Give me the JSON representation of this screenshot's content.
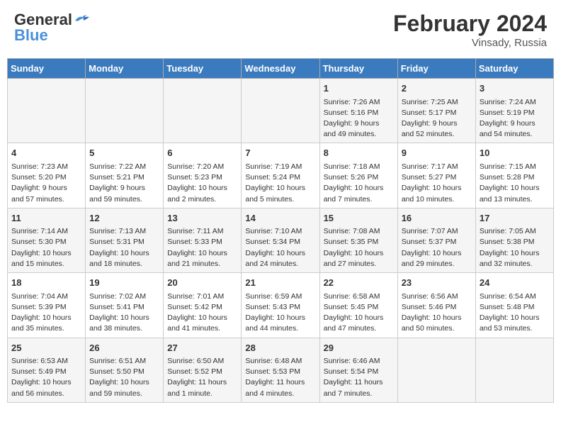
{
  "logo": {
    "part1": "General",
    "part2": "Blue"
  },
  "title": "February 2024",
  "location": "Vinsady, Russia",
  "days_of_week": [
    "Sunday",
    "Monday",
    "Tuesday",
    "Wednesday",
    "Thursday",
    "Friday",
    "Saturday"
  ],
  "weeks": [
    [
      {
        "day": "",
        "info": ""
      },
      {
        "day": "",
        "info": ""
      },
      {
        "day": "",
        "info": ""
      },
      {
        "day": "",
        "info": ""
      },
      {
        "day": "1",
        "info": "Sunrise: 7:26 AM\nSunset: 5:16 PM\nDaylight: 9 hours\nand 49 minutes."
      },
      {
        "day": "2",
        "info": "Sunrise: 7:25 AM\nSunset: 5:17 PM\nDaylight: 9 hours\nand 52 minutes."
      },
      {
        "day": "3",
        "info": "Sunrise: 7:24 AM\nSunset: 5:19 PM\nDaylight: 9 hours\nand 54 minutes."
      }
    ],
    [
      {
        "day": "4",
        "info": "Sunrise: 7:23 AM\nSunset: 5:20 PM\nDaylight: 9 hours\nand 57 minutes."
      },
      {
        "day": "5",
        "info": "Sunrise: 7:22 AM\nSunset: 5:21 PM\nDaylight: 9 hours\nand 59 minutes."
      },
      {
        "day": "6",
        "info": "Sunrise: 7:20 AM\nSunset: 5:23 PM\nDaylight: 10 hours\nand 2 minutes."
      },
      {
        "day": "7",
        "info": "Sunrise: 7:19 AM\nSunset: 5:24 PM\nDaylight: 10 hours\nand 5 minutes."
      },
      {
        "day": "8",
        "info": "Sunrise: 7:18 AM\nSunset: 5:26 PM\nDaylight: 10 hours\nand 7 minutes."
      },
      {
        "day": "9",
        "info": "Sunrise: 7:17 AM\nSunset: 5:27 PM\nDaylight: 10 hours\nand 10 minutes."
      },
      {
        "day": "10",
        "info": "Sunrise: 7:15 AM\nSunset: 5:28 PM\nDaylight: 10 hours\nand 13 minutes."
      }
    ],
    [
      {
        "day": "11",
        "info": "Sunrise: 7:14 AM\nSunset: 5:30 PM\nDaylight: 10 hours\nand 15 minutes."
      },
      {
        "day": "12",
        "info": "Sunrise: 7:13 AM\nSunset: 5:31 PM\nDaylight: 10 hours\nand 18 minutes."
      },
      {
        "day": "13",
        "info": "Sunrise: 7:11 AM\nSunset: 5:33 PM\nDaylight: 10 hours\nand 21 minutes."
      },
      {
        "day": "14",
        "info": "Sunrise: 7:10 AM\nSunset: 5:34 PM\nDaylight: 10 hours\nand 24 minutes."
      },
      {
        "day": "15",
        "info": "Sunrise: 7:08 AM\nSunset: 5:35 PM\nDaylight: 10 hours\nand 27 minutes."
      },
      {
        "day": "16",
        "info": "Sunrise: 7:07 AM\nSunset: 5:37 PM\nDaylight: 10 hours\nand 29 minutes."
      },
      {
        "day": "17",
        "info": "Sunrise: 7:05 AM\nSunset: 5:38 PM\nDaylight: 10 hours\nand 32 minutes."
      }
    ],
    [
      {
        "day": "18",
        "info": "Sunrise: 7:04 AM\nSunset: 5:39 PM\nDaylight: 10 hours\nand 35 minutes."
      },
      {
        "day": "19",
        "info": "Sunrise: 7:02 AM\nSunset: 5:41 PM\nDaylight: 10 hours\nand 38 minutes."
      },
      {
        "day": "20",
        "info": "Sunrise: 7:01 AM\nSunset: 5:42 PM\nDaylight: 10 hours\nand 41 minutes."
      },
      {
        "day": "21",
        "info": "Sunrise: 6:59 AM\nSunset: 5:43 PM\nDaylight: 10 hours\nand 44 minutes."
      },
      {
        "day": "22",
        "info": "Sunrise: 6:58 AM\nSunset: 5:45 PM\nDaylight: 10 hours\nand 47 minutes."
      },
      {
        "day": "23",
        "info": "Sunrise: 6:56 AM\nSunset: 5:46 PM\nDaylight: 10 hours\nand 50 minutes."
      },
      {
        "day": "24",
        "info": "Sunrise: 6:54 AM\nSunset: 5:48 PM\nDaylight: 10 hours\nand 53 minutes."
      }
    ],
    [
      {
        "day": "25",
        "info": "Sunrise: 6:53 AM\nSunset: 5:49 PM\nDaylight: 10 hours\nand 56 minutes."
      },
      {
        "day": "26",
        "info": "Sunrise: 6:51 AM\nSunset: 5:50 PM\nDaylight: 10 hours\nand 59 minutes."
      },
      {
        "day": "27",
        "info": "Sunrise: 6:50 AM\nSunset: 5:52 PM\nDaylight: 11 hours\nand 1 minute."
      },
      {
        "day": "28",
        "info": "Sunrise: 6:48 AM\nSunset: 5:53 PM\nDaylight: 11 hours\nand 4 minutes."
      },
      {
        "day": "29",
        "info": "Sunrise: 6:46 AM\nSunset: 5:54 PM\nDaylight: 11 hours\nand 7 minutes."
      },
      {
        "day": "",
        "info": ""
      },
      {
        "day": "",
        "info": ""
      }
    ]
  ]
}
